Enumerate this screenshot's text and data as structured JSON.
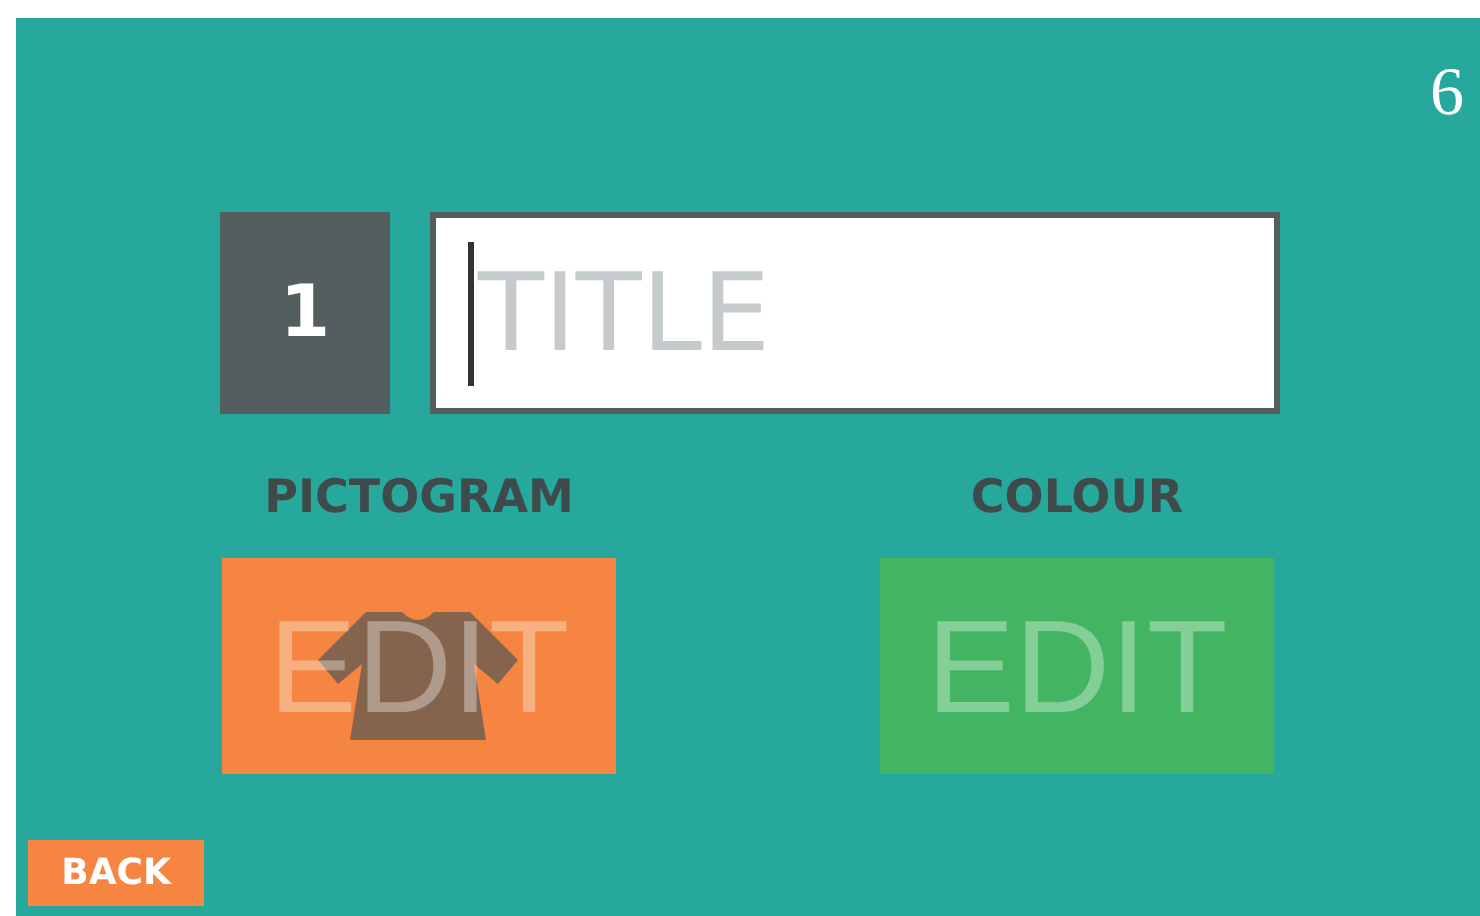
{
  "page_number": "6",
  "entry": {
    "number": "1",
    "title": {
      "placeholder": "TITLE",
      "focused": true
    }
  },
  "sections": [
    {
      "kind": "pictogram",
      "label": "PICTOGRAM",
      "button": "EDIT"
    },
    {
      "kind": "colour",
      "label": "COLOUR",
      "button": "EDIT"
    }
  ],
  "back_button": "BACK"
}
